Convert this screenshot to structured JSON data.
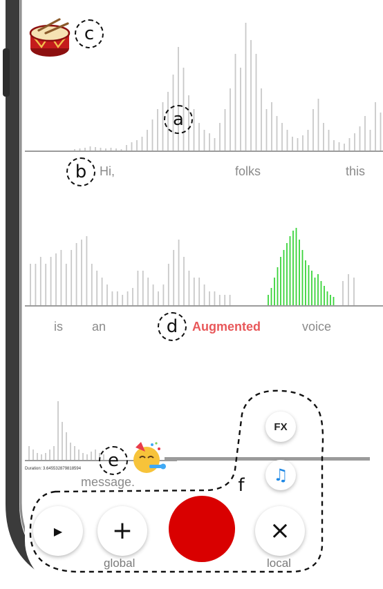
{
  "markers": {
    "a": "a",
    "b": "b",
    "c": "c",
    "d": "d",
    "e": "e",
    "f": "f"
  },
  "row1": {
    "words": [
      "Hi,",
      "folks",
      "this"
    ]
  },
  "row2": {
    "words": [
      "is",
      "an",
      "Augmented",
      "voice"
    ],
    "highlighted": "Augmented"
  },
  "row3": {
    "words": [
      "message."
    ],
    "duration": "Duration: 3.645532879818594"
  },
  "buttons": {
    "fx_label": "FX",
    "music_note": "♫",
    "play": "▶",
    "add": "+",
    "close": "×",
    "global_label": "global",
    "local_label": "local"
  },
  "colors": {
    "bar_gray": "#c8c8c8",
    "bar_green": "#39d33a",
    "record_red": "#d90000",
    "highlight": "#e8585a"
  }
}
